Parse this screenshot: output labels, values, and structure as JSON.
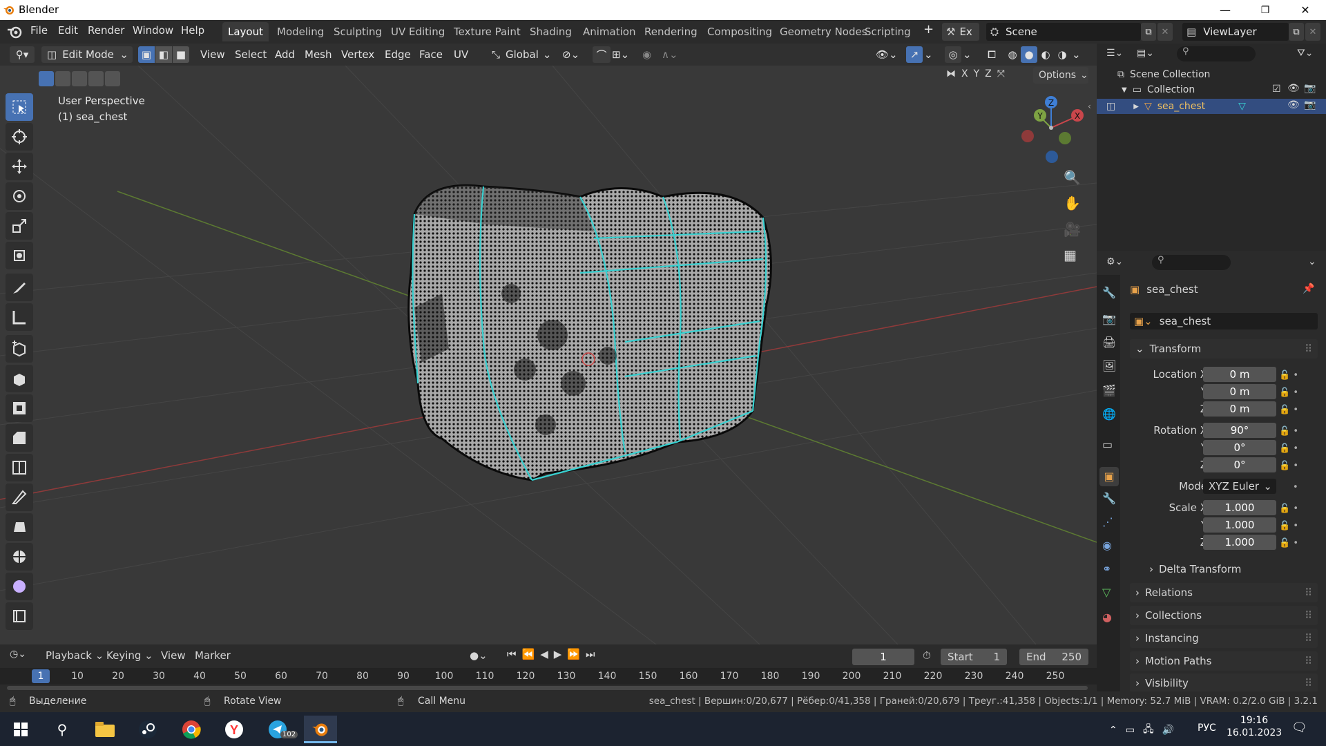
{
  "window": {
    "title": "Blender",
    "minimize": "—",
    "maximize": "❐",
    "close": "✕"
  },
  "menu": [
    "File",
    "Edit",
    "Render",
    "Window",
    "Help"
  ],
  "workspaces": [
    "Layout",
    "Modeling",
    "Sculpting",
    "UV Editing",
    "Texture Paint",
    "Shading",
    "Animation",
    "Rendering",
    "Compositing",
    "Geometry Nodes",
    "Scripting"
  ],
  "active_workspace": "Layout",
  "scene": {
    "label": "Scene",
    "view_layer": "ViewLayer",
    "engine_short": "Ex"
  },
  "viewport_header": {
    "mode": "Edit Mode",
    "menus": [
      "View",
      "Select",
      "Add",
      "Mesh",
      "Vertex",
      "Edge",
      "Face",
      "UV"
    ],
    "orientation": "Global",
    "options": "Options",
    "axes": [
      "X",
      "Y",
      "Z"
    ]
  },
  "viewport": {
    "perspective": "User Perspective",
    "object_label": "(1) sea_chest",
    "gizmo": {
      "z": "Z",
      "y": "Y",
      "x": "X"
    }
  },
  "outliner": {
    "scene_collection": "Scene Collection",
    "collection": "Collection",
    "object": "sea_chest"
  },
  "properties": {
    "object_name": "sea_chest",
    "datablock": "sea_chest",
    "transform_header": "Transform",
    "location_label": "Location X",
    "rotation_label": "Rotation X",
    "scale_label": "Scale X",
    "y_label": "Y",
    "z_label": "Z",
    "location": [
      "0 m",
      "0 m",
      "0 m"
    ],
    "rotation": [
      "90°",
      "0°",
      "0°"
    ],
    "mode_label": "Mode",
    "mode_value": "XYZ Euler",
    "scale": [
      "1.000",
      "1.000",
      "1.000"
    ],
    "delta_transform": "Delta Transform",
    "sections": [
      "Relations",
      "Collections",
      "Instancing",
      "Motion Paths",
      "Visibility"
    ]
  },
  "timeline": {
    "menus": [
      "Playback",
      "Keying",
      "View",
      "Marker"
    ],
    "current_frame": "1",
    "start_label": "Start",
    "start": "1",
    "end_label": "End",
    "end": "250",
    "ruler": [
      "1",
      "10",
      "20",
      "30",
      "40",
      "50",
      "60",
      "70",
      "80",
      "90",
      "100",
      "110",
      "120",
      "130",
      "140",
      "150",
      "160",
      "170",
      "180",
      "190",
      "200",
      "210",
      "220",
      "230",
      "240",
      "250"
    ]
  },
  "statusbar": {
    "left": "Выделение",
    "middle": "Rotate View",
    "right_hint": "Call Menu",
    "stats": "sea_chest | Вершин:0/20,677 | Рёбер:0/41,358 | Граней:0/20,679 | Треуг.:41,358 | Objects:1/1 | Memory: 52.7 MiB | VRAM: 0.2/2.0 GiB | 3.2.1"
  },
  "taskbar": {
    "language": "РУС",
    "time": "19:16",
    "date": "16.01.2023",
    "telegram_badge": "102"
  },
  "colors": {
    "accent": "#4772b3",
    "selected_row": "#334d80",
    "x_axis": "#c9464b",
    "y_axis": "#7ea343",
    "z_axis": "#3f7fd6",
    "mesh_edge": "#33cfcf"
  }
}
